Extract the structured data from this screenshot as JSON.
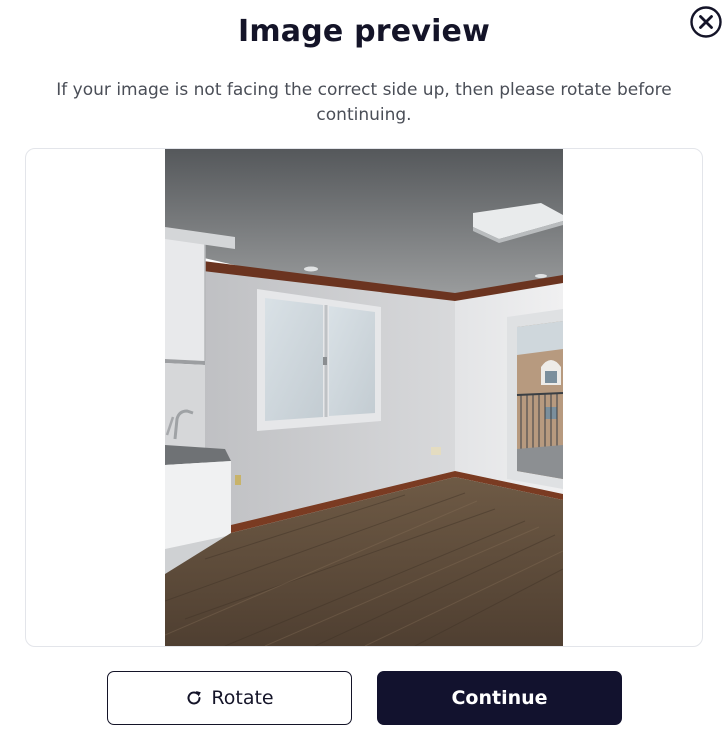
{
  "modal": {
    "title": "Image preview",
    "subtitle": "If your image is not facing the correct side up, then please rotate before continuing.",
    "close_icon": "close-circle-icon"
  },
  "preview": {
    "image_label": "Photo of empty room with white walls, window, wooden floor and kitchenette"
  },
  "actions": {
    "rotate_label": "Rotate",
    "rotate_icon": "rotate-icon",
    "continue_label": "Continue"
  },
  "colors": {
    "primary": "#12122e",
    "text": "#141428",
    "muted": "#4a4e57",
    "border": "#e3e5ea"
  }
}
